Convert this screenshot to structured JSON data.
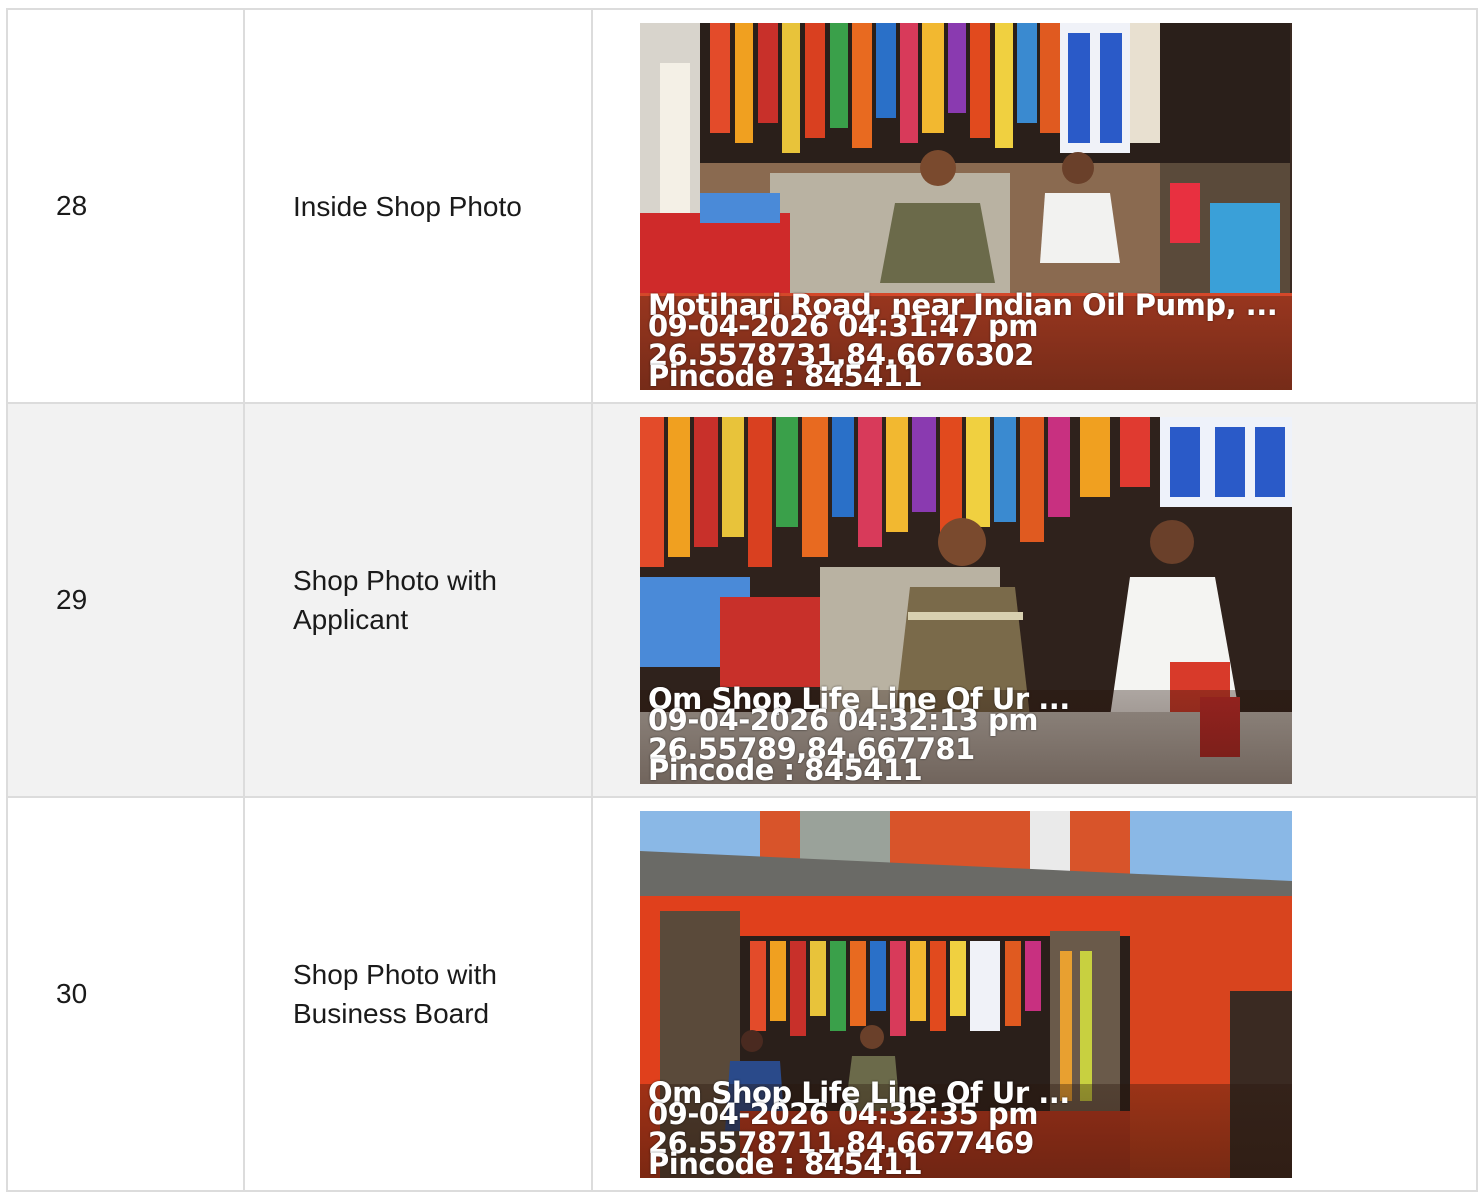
{
  "rows": [
    {
      "number": "28",
      "label": "Inside Shop Photo",
      "stamp": {
        "address": "Motihari Road, near Indian Oil Pump, ...",
        "datetime": "09-04-2026 04:31:47 pm",
        "coords": "26.5578731,84.6676302",
        "pincode": "Pincode : 845411"
      }
    },
    {
      "number": "29",
      "label": "Shop Photo with Applicant",
      "stamp": {
        "address": "Om Shop Life Line Of Ur ...",
        "datetime": "09-04-2026 04:32:13 pm",
        "coords": "26.55789,84.667781",
        "pincode": "Pincode : 845411"
      }
    },
    {
      "number": "30",
      "label": "Shop Photo with Business Board",
      "stamp": {
        "address": "Om Shop Life Line Of Ur ...",
        "datetime": "09-04-2026 04:32:35 pm",
        "coords": "26.5578711,84.6677469",
        "pincode": "Pincode : 845411"
      }
    }
  ],
  "colors": {
    "border": "#dcdcdc",
    "alt_row": "#f2f2f2",
    "shop_orange": "#e0401c"
  }
}
